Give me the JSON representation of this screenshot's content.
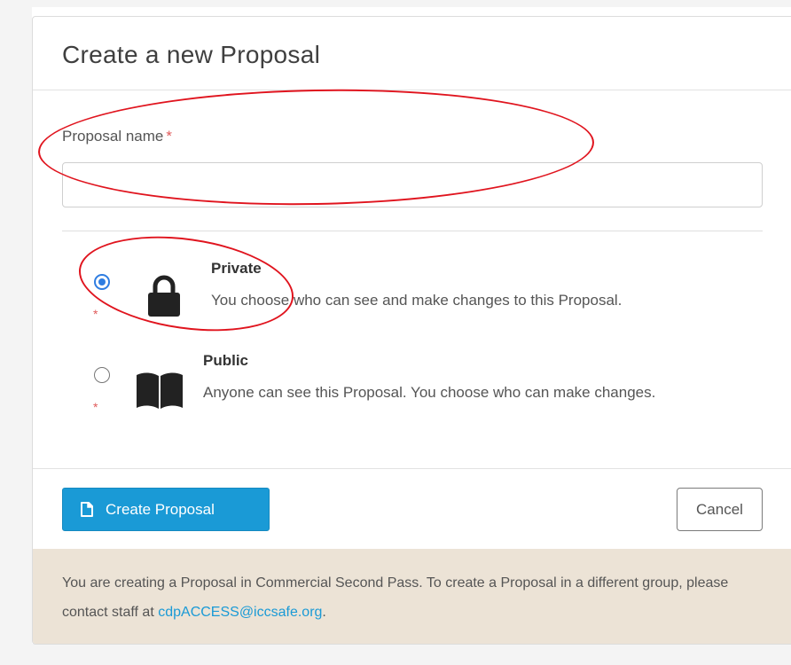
{
  "modal": {
    "title": "Create a new Proposal"
  },
  "form": {
    "name_label": "Proposal name",
    "required_marker": "*",
    "name_value": "",
    "name_placeholder": ""
  },
  "visibility": {
    "selected": "private",
    "options": [
      {
        "key": "private",
        "title": "Private",
        "description": "You choose who can see and make changes to this Proposal.",
        "icon": "lock-icon",
        "checked": true
      },
      {
        "key": "public",
        "title": "Public",
        "description": "Anyone can see this Proposal. You choose who can make changes.",
        "icon": "book-icon",
        "checked": false
      }
    ]
  },
  "footer": {
    "create_label": "Create Proposal",
    "create_icon": "document-icon",
    "cancel_label": "Cancel"
  },
  "info": {
    "text_before": "You are creating a Proposal in Commercial Second Pass. To create a Proposal in a different group, please contact staff at ",
    "email": "cdpACCESS@iccsafe.org",
    "text_after": "."
  },
  "colors": {
    "primary": "#1a9ad6",
    "required": "#e05a5a",
    "radio_checked": "#2f7de1",
    "info_bg": "#ece3d6",
    "annotation": "#e0141e"
  }
}
